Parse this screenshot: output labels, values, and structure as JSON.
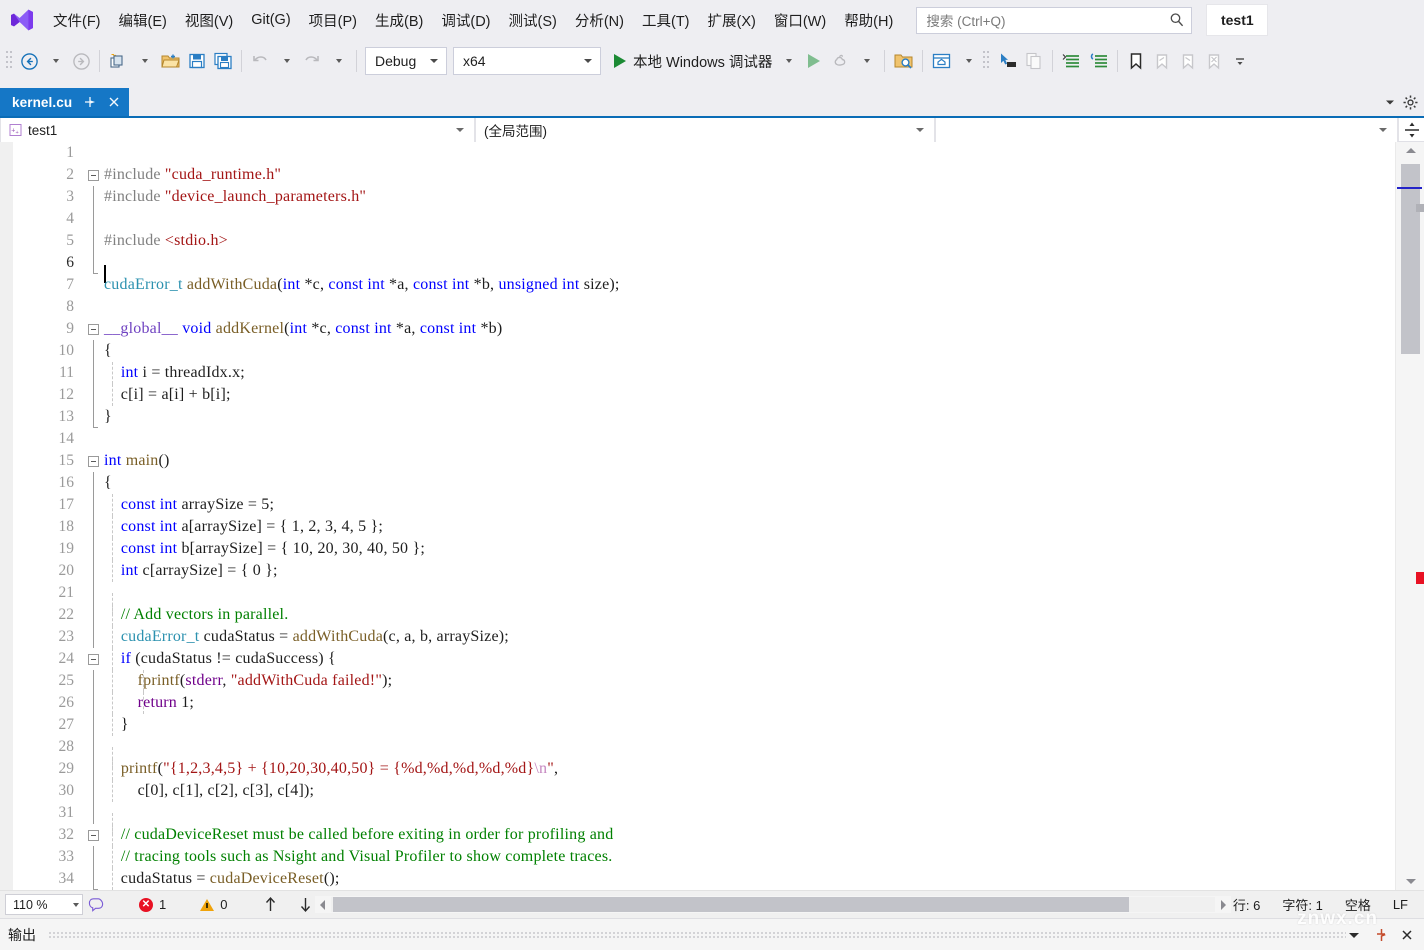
{
  "app": {
    "logo_icon": "visual-studio-logo",
    "user_chip": "test1"
  },
  "menubar": {
    "items": [
      {
        "label": "文件(F)"
      },
      {
        "label": "编辑(E)"
      },
      {
        "label": "视图(V)"
      },
      {
        "label": "Git(G)"
      },
      {
        "label": "项目(P)"
      },
      {
        "label": "生成(B)"
      },
      {
        "label": "调试(D)"
      },
      {
        "label": "测试(S)"
      },
      {
        "label": "分析(N)"
      },
      {
        "label": "工具(T)"
      },
      {
        "label": "扩展(X)"
      },
      {
        "label": "窗口(W)"
      },
      {
        "label": "帮助(H)"
      }
    ],
    "search_placeholder": "搜索 (Ctrl+Q)",
    "search_value": ""
  },
  "toolbar": {
    "back_icon": "navigate-back-icon",
    "forward_icon": "navigate-forward-icon",
    "new_item_icon": "new-item-icon",
    "open_icon": "open-file-icon",
    "save_icon": "save-icon",
    "save_all_icon": "save-all-icon",
    "undo_icon": "undo-icon",
    "redo_icon": "redo-icon",
    "configuration": "Debug",
    "platform": "x64",
    "run_label": "本地 Windows 调试器",
    "start_icon": "start-debug-icon",
    "start_no_debug_icon": "start-without-debugging-icon",
    "hot_reload_icon": "hot-reload-icon",
    "solution_explorer_icon": "solution-explorer-search-icon",
    "home_window_icon": "home-window-icon",
    "pointer_icon": "select-element-icon",
    "copy_icon": "copy-icon",
    "comment_icon": "comment-selection-icon",
    "uncomment_icon": "uncomment-selection-icon",
    "bookmark_icon": "toggle-bookmark-icon",
    "prev_bookmark_icon": "previous-bookmark-icon",
    "next_bookmark_icon": "next-bookmark-icon",
    "clear_bookmarks_icon": "clear-bookmarks-icon",
    "overflow_icon": "toolbar-overflow-icon"
  },
  "tabbar": {
    "active_tab": "kernel.cu",
    "pin_icon": "pin-tab-icon",
    "close_icon": "close-tab-icon",
    "dropdown_icon": "tab-list-dropdown-icon",
    "settings_icon": "gear-icon"
  },
  "navbar": {
    "project": "test1",
    "project_icon": "cpp-project-icon",
    "scope": "(全局范围)",
    "member": "",
    "split_icon": "split-editor-icon"
  },
  "editor": {
    "caret_line": 6,
    "lines": [
      {
        "n": 1,
        "fold": "",
        "guides": [],
        "tokens": []
      },
      {
        "n": 2,
        "fold": "minus",
        "guides": [],
        "tokens": [
          {
            "t": "#include ",
            "c": "pre"
          },
          {
            "t": "\"cuda_runtime.h\"",
            "c": "str"
          }
        ]
      },
      {
        "n": 3,
        "fold": "line",
        "guides": [],
        "tokens": [
          {
            "t": "#include ",
            "c": "pre"
          },
          {
            "t": "\"device_launch_parameters.h\"",
            "c": "str"
          }
        ]
      },
      {
        "n": 4,
        "fold": "line",
        "guides": [],
        "tokens": []
      },
      {
        "n": 5,
        "fold": "line",
        "guides": [],
        "tokens": [
          {
            "t": "#include ",
            "c": "pre"
          },
          {
            "t": "<stdio.h>",
            "c": "str"
          }
        ]
      },
      {
        "n": 6,
        "fold": "lbracket",
        "guides": [],
        "tokens": []
      },
      {
        "n": 7,
        "fold": "",
        "guides": [],
        "tokens": [
          {
            "t": "cudaError_t ",
            "c": "typ"
          },
          {
            "t": "addWithCuda",
            "c": "fn"
          },
          {
            "t": "(",
            "c": "var"
          },
          {
            "t": "int",
            "c": "kw"
          },
          {
            "t": " *c, ",
            "c": "var"
          },
          {
            "t": "const int",
            "c": "kw"
          },
          {
            "t": " *a, ",
            "c": "var"
          },
          {
            "t": "const int",
            "c": "kw"
          },
          {
            "t": " *b, ",
            "c": "var"
          },
          {
            "t": "unsigned int",
            "c": "kw"
          },
          {
            "t": " size);",
            "c": "var"
          }
        ]
      },
      {
        "n": 8,
        "fold": "",
        "guides": [],
        "tokens": []
      },
      {
        "n": 9,
        "fold": "minus",
        "guides": [],
        "tokens": [
          {
            "t": "__global__",
            "c": "gl"
          },
          {
            "t": " ",
            "c": "var"
          },
          {
            "t": "void",
            "c": "kw"
          },
          {
            "t": " ",
            "c": "var"
          },
          {
            "t": "addKernel",
            "c": "fn"
          },
          {
            "t": "(",
            "c": "var"
          },
          {
            "t": "int",
            "c": "kw"
          },
          {
            "t": " *c, ",
            "c": "var"
          },
          {
            "t": "const int",
            "c": "kw"
          },
          {
            "t": " *a, ",
            "c": "var"
          },
          {
            "t": "const int",
            "c": "kw"
          },
          {
            "t": " *b)",
            "c": "var"
          }
        ]
      },
      {
        "n": 10,
        "fold": "line",
        "guides": [],
        "tokens": [
          {
            "t": "{",
            "c": "var"
          }
        ]
      },
      {
        "n": 11,
        "fold": "line",
        "guides": [
          0
        ],
        "tokens": [
          {
            "t": "    ",
            "c": "var"
          },
          {
            "t": "int",
            "c": "kw"
          },
          {
            "t": " i = threadIdx.x;",
            "c": "var"
          }
        ]
      },
      {
        "n": 12,
        "fold": "line",
        "guides": [
          0
        ],
        "tokens": [
          {
            "t": "    c[i] = ",
            "c": "var"
          },
          {
            "t": "a",
            "c": "var"
          },
          {
            "t": "[i] + ",
            "c": "var"
          },
          {
            "t": "b",
            "c": "var"
          },
          {
            "t": "[i];",
            "c": "var"
          }
        ]
      },
      {
        "n": 13,
        "fold": "lbracket",
        "guides": [],
        "tokens": [
          {
            "t": "}",
            "c": "var"
          }
        ]
      },
      {
        "n": 14,
        "fold": "",
        "guides": [],
        "tokens": []
      },
      {
        "n": 15,
        "fold": "minus",
        "guides": [],
        "tokens": [
          {
            "t": "int",
            "c": "kw"
          },
          {
            "t": " ",
            "c": "var"
          },
          {
            "t": "main",
            "c": "fn"
          },
          {
            "t": "()",
            "c": "var"
          }
        ]
      },
      {
        "n": 16,
        "fold": "line",
        "guides": [],
        "tokens": [
          {
            "t": "{",
            "c": "var"
          }
        ]
      },
      {
        "n": 17,
        "fold": "line",
        "guides": [
          0
        ],
        "tokens": [
          {
            "t": "    ",
            "c": "var"
          },
          {
            "t": "const int",
            "c": "kw"
          },
          {
            "t": " arraySize = 5;",
            "c": "var"
          }
        ]
      },
      {
        "n": 18,
        "fold": "line",
        "guides": [
          0
        ],
        "tokens": [
          {
            "t": "    ",
            "c": "var"
          },
          {
            "t": "const int",
            "c": "kw"
          },
          {
            "t": " a[arraySize] = { 1, 2, 3, 4, 5 };",
            "c": "var"
          }
        ]
      },
      {
        "n": 19,
        "fold": "line",
        "guides": [
          0
        ],
        "tokens": [
          {
            "t": "    ",
            "c": "var"
          },
          {
            "t": "const int",
            "c": "kw"
          },
          {
            "t": " b[arraySize] = { 10, 20, 30, 40, 50 };",
            "c": "var"
          }
        ]
      },
      {
        "n": 20,
        "fold": "line",
        "guides": [
          0
        ],
        "tokens": [
          {
            "t": "    ",
            "c": "var"
          },
          {
            "t": "int",
            "c": "kw"
          },
          {
            "t": " c[arraySize] = { 0 };",
            "c": "var"
          }
        ]
      },
      {
        "n": 21,
        "fold": "line",
        "guides": [
          0
        ],
        "tokens": []
      },
      {
        "n": 22,
        "fold": "line",
        "guides": [
          0
        ],
        "tokens": [
          {
            "t": "    ",
            "c": "var"
          },
          {
            "t": "// Add vectors in parallel.",
            "c": "cmt"
          }
        ]
      },
      {
        "n": 23,
        "fold": "line",
        "guides": [
          0
        ],
        "tokens": [
          {
            "t": "    ",
            "c": "var"
          },
          {
            "t": "cudaError_t ",
            "c": "typ"
          },
          {
            "t": "cudaStatus = ",
            "c": "var"
          },
          {
            "t": "addWithCuda",
            "c": "fn"
          },
          {
            "t": "(c, a, b, arraySize);",
            "c": "var"
          }
        ]
      },
      {
        "n": 24,
        "fold": "minus2",
        "guides": [
          0
        ],
        "tokens": [
          {
            "t": "    ",
            "c": "var"
          },
          {
            "t": "if",
            "c": "kw"
          },
          {
            "t": " (cudaStatus != cudaSuccess) {",
            "c": "var"
          }
        ]
      },
      {
        "n": 25,
        "fold": "line",
        "guides": [
          0,
          1
        ],
        "tokens": [
          {
            "t": "        ",
            "c": "var"
          },
          {
            "t": "fprintf",
            "c": "fn"
          },
          {
            "t": "(",
            "c": "var"
          },
          {
            "t": "stderr",
            "c": "mac"
          },
          {
            "t": ", ",
            "c": "var"
          },
          {
            "t": "\"addWithCuda failed!\"",
            "c": "str"
          },
          {
            "t": ");",
            "c": "var"
          }
        ]
      },
      {
        "n": 26,
        "fold": "line",
        "guides": [
          0,
          1
        ],
        "tokens": [
          {
            "t": "        ",
            "c": "var"
          },
          {
            "t": "return",
            "c": "mac"
          },
          {
            "t": " 1;",
            "c": "var"
          }
        ]
      },
      {
        "n": 27,
        "fold": "line",
        "guides": [
          0
        ],
        "tokens": [
          {
            "t": "    }",
            "c": "var"
          }
        ]
      },
      {
        "n": 28,
        "fold": "line",
        "guides": [
          0
        ],
        "tokens": []
      },
      {
        "n": 29,
        "fold": "line",
        "guides": [
          0
        ],
        "tokens": [
          {
            "t": "    ",
            "c": "var"
          },
          {
            "t": "printf",
            "c": "fn"
          },
          {
            "t": "(",
            "c": "var"
          },
          {
            "t": "\"{1,2,3,4,5} + {10,20,30,40,50} = {%d,%d,%d,%d,%d}",
            "c": "str"
          },
          {
            "t": "\\n",
            "c": "esc"
          },
          {
            "t": "\"",
            "c": "str"
          },
          {
            "t": ",",
            "c": "var"
          }
        ]
      },
      {
        "n": 30,
        "fold": "line",
        "guides": [
          0
        ],
        "tokens": [
          {
            "t": "        c[0], c[1], c[2], c[3], c[4]);",
            "c": "var"
          }
        ]
      },
      {
        "n": 31,
        "fold": "line",
        "guides": [
          0
        ],
        "tokens": []
      },
      {
        "n": 32,
        "fold": "minus2",
        "guides": [
          0
        ],
        "tokens": [
          {
            "t": "    ",
            "c": "var"
          },
          {
            "t": "// cudaDeviceReset must be called before exiting in order for profiling and",
            "c": "cmt"
          }
        ]
      },
      {
        "n": 33,
        "fold": "line",
        "guides": [
          0
        ],
        "tokens": [
          {
            "t": "    ",
            "c": "var"
          },
          {
            "t": "// tracing tools such as Nsight and Visual Profiler to show complete traces.",
            "c": "cmt"
          }
        ]
      },
      {
        "n": 34,
        "fold": "lbracket2",
        "guides": [
          0
        ],
        "tokens": [
          {
            "t": "    cudaStatus = ",
            "c": "var"
          },
          {
            "t": "cudaDeviceReset",
            "c": "fn"
          },
          {
            "t": "();",
            "c": "var"
          }
        ]
      }
    ]
  },
  "statusbar": {
    "zoom": "110 %",
    "intellisense_icon": "intellisense-icon",
    "error_count": "1",
    "warning_count": "0",
    "prev_icon": "previous-error-icon",
    "next_icon": "next-error-icon",
    "line_label": "行: 6",
    "column_label": "字符: 1",
    "insert_mode": "空格",
    "line_ending": "LF"
  },
  "output_panel": {
    "title": "输出",
    "dropdown_icon": "chevron-down-icon",
    "pin_icon": "pin-icon",
    "close_icon": "close-icon"
  },
  "watermark": {
    "text": "znwx.cn"
  },
  "colors": {
    "accent_blue": "#1577c6",
    "tab_underline": "#0a6cb6",
    "chrome_bg": "#eeeef2",
    "editor_bg": "#ffffff",
    "error_red": "#e81123",
    "warning_amber": "#f0a30a",
    "run_green": "#1b8a34",
    "keyword_blue": "#0000ff",
    "string_red": "#a31515",
    "comment_green": "#008000",
    "type_teal": "#2b91af",
    "function_brown": "#795e26",
    "macro_purple": "#6f008a"
  }
}
